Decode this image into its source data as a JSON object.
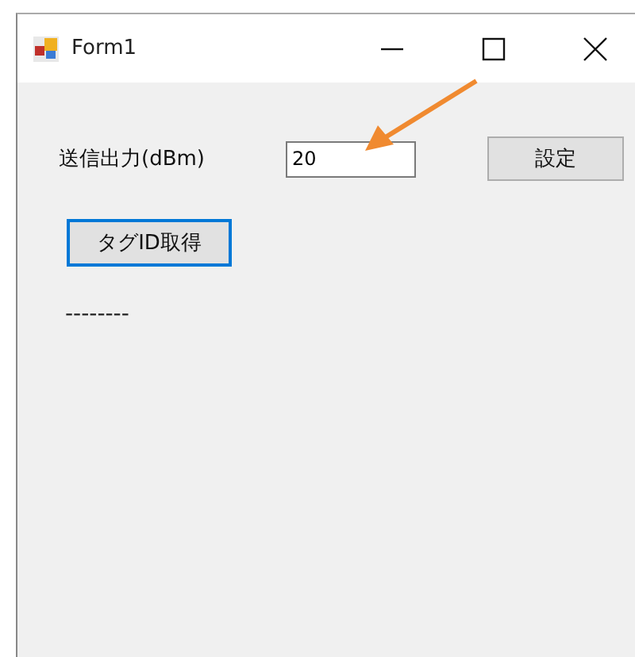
{
  "window": {
    "title": "Form1"
  },
  "power_label": "送信出力(dBm)",
  "power_field": {
    "value": "20"
  },
  "set_button": {
    "label": "設定",
    "focused": false
  },
  "tag_button": {
    "label": "タグID取得",
    "focused": true
  },
  "result": "--------"
}
